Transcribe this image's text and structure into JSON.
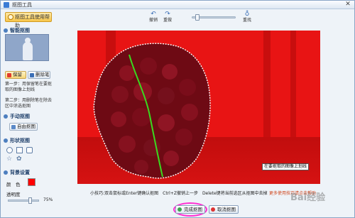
{
  "window": {
    "title": "抠图工具"
  },
  "help_button": {
    "label": "抠图工具使用帮助"
  },
  "toolbar": {
    "undo_label": "撤销",
    "redo_label": "重做",
    "reset_label": "重找"
  },
  "sidebar": {
    "smart": {
      "title": "智能抠图",
      "keep_label": "保留",
      "remove_label": "删除笔",
      "step1": "第一步：用保留笔在要抠取的图像上划线",
      "step2": "第二步：用删除笔在除去区中涂选抠图"
    },
    "manual": {
      "title": "手动抠图",
      "free_label": "自由抠图"
    },
    "shape": {
      "title": "形状抠图"
    },
    "bg": {
      "title": "背景设置",
      "color_label": "颜　色",
      "opacity_label": "透明度",
      "opacity_value": "75%"
    }
  },
  "canvas": {
    "tooltip": "在要抠取的图像上划线"
  },
  "footer": {
    "hint": "小技巧:双击鼠标或Enter键确认抠图　Ctrl+Z撤销上一步　Delete键将当前选区从抠图中去掉",
    "hint_red": "更多使用技巧请点击帮助",
    "ok_label": "完成抠图",
    "cancel_label": "取消抠图",
    "watermark": "Bai经验"
  },
  "colors": {
    "background_fill": "#ff0000",
    "accent": "#ff2fd2"
  }
}
